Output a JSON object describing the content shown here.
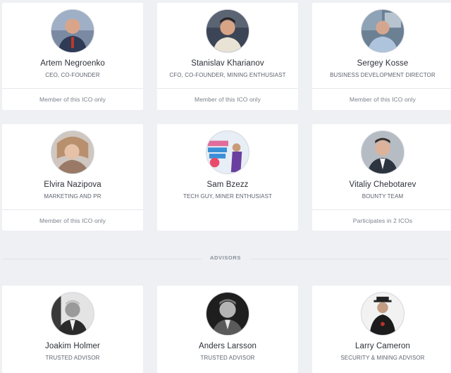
{
  "team": [
    {
      "name": "Artem Negroenko",
      "role": "CEO, CO-FOUNDER",
      "footer": "Member of this ICO only",
      "avatar_icon": "person-photo"
    },
    {
      "name": "Stanislav Kharianov",
      "role": "CFO, CO-FOUNDER, MINING ENTHUSIAST",
      "footer": "Member of this ICO only",
      "avatar_icon": "person-photo"
    },
    {
      "name": "Sergey Kosse",
      "role": "BUSINESS DEVELOPMENT DIRECTOR",
      "footer": "Member of this ICO only",
      "avatar_icon": "person-photo"
    },
    {
      "name": "Elvira Nazipova",
      "role": "MARKETING AND PR",
      "footer": "Member of this ICO only",
      "avatar_icon": "person-photo"
    },
    {
      "name": "Sam Bzezz",
      "role": "TECH GUY, MINER ENTHUSIAST",
      "footer": "",
      "avatar_icon": "person-photo"
    },
    {
      "name": "Vitaliy Chebotarev",
      "role": "BOUNTY TEAM",
      "footer": "Participates in 2 ICOs",
      "avatar_icon": "person-photo"
    }
  ],
  "section": {
    "advisors_label": "ADVISORS"
  },
  "advisors": [
    {
      "name": "Joakim Holmer",
      "role": "TRUSTED ADVISOR",
      "avatar_icon": "person-photo"
    },
    {
      "name": "Anders Larsson",
      "role": "TRUSTED ADVISOR",
      "avatar_icon": "person-photo"
    },
    {
      "name": "Larry Cameron",
      "role": "SECURITY & MINING ADVISOR",
      "avatar_icon": "person-photo"
    }
  ],
  "colors": {
    "background": "#eef0f4",
    "card": "#ffffff",
    "text": "#2b2f36",
    "muted": "#7a808a"
  }
}
